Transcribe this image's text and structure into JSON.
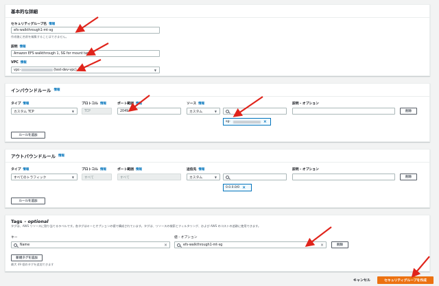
{
  "basic": {
    "title": "基本的な詳細",
    "sg_name_label": "セキュリティグループ名",
    "sg_name_value": "efs-walkthrough1-mt-sg",
    "sg_name_hint": "作成後に名前を編集することはできません。",
    "desc_label": "説明",
    "desc_value": "Amazon EFS walkthrough 1, SG for mount target",
    "vpc_label": "VPC",
    "vpc_prefix": "vpc-",
    "vpc_suffix": "(test-dev-vpc)"
  },
  "info": "情報",
  "inbound": {
    "title": "インバウンドルール",
    "col_type": "タイプ",
    "col_protocol": "プロトコル",
    "col_port": "ポート範囲",
    "col_source": "ソース",
    "col_desc": "説明 - オプション",
    "type_value": "カスタム TCP",
    "protocol_value": "TCP",
    "port_value": "2049",
    "source_mode": "カスタム",
    "source_token_prefix": "sg-",
    "delete_label": "削除",
    "add_rule_label": "ルールを追加"
  },
  "outbound": {
    "title": "アウトバウンドルール",
    "col_type": "タイプ",
    "col_protocol": "プロトコル",
    "col_port": "ポート範囲",
    "col_dest": "送信先",
    "col_desc": "説明 - オプション",
    "type_value": "すべてのトラフィック",
    "protocol_value": "すべて",
    "port_value": "すべて",
    "dest_mode": "カスタム",
    "dest_token": "0.0.0.0/0",
    "delete_label": "削除",
    "add_rule_label": "ルールを追加"
  },
  "tags": {
    "title": "Tags",
    "title_optional": "- optional",
    "description": "タグは、AWS リソースに割り当てるラベルです。各タグはキーとオプションの値で構成されています。タグは、リソースの検索とフィルタリング、および AWS のコストの追跡に使用できます。",
    "key_label": "キー",
    "value_label": "値 - オプション",
    "key_value": "Name",
    "value_value": "efs-walkthrough1-mt-sg",
    "delete_label": "削除",
    "add_tag_label": "新規タグを追加",
    "limit_hint": "最大 49 個のタグを追加できます"
  },
  "footer": {
    "cancel_label": "キャンセル",
    "create_label": "セキュリティグループを作成"
  },
  "colors": {
    "accent": "#0073bb",
    "primary": "#ec7211",
    "annotation": "#e0241b"
  }
}
